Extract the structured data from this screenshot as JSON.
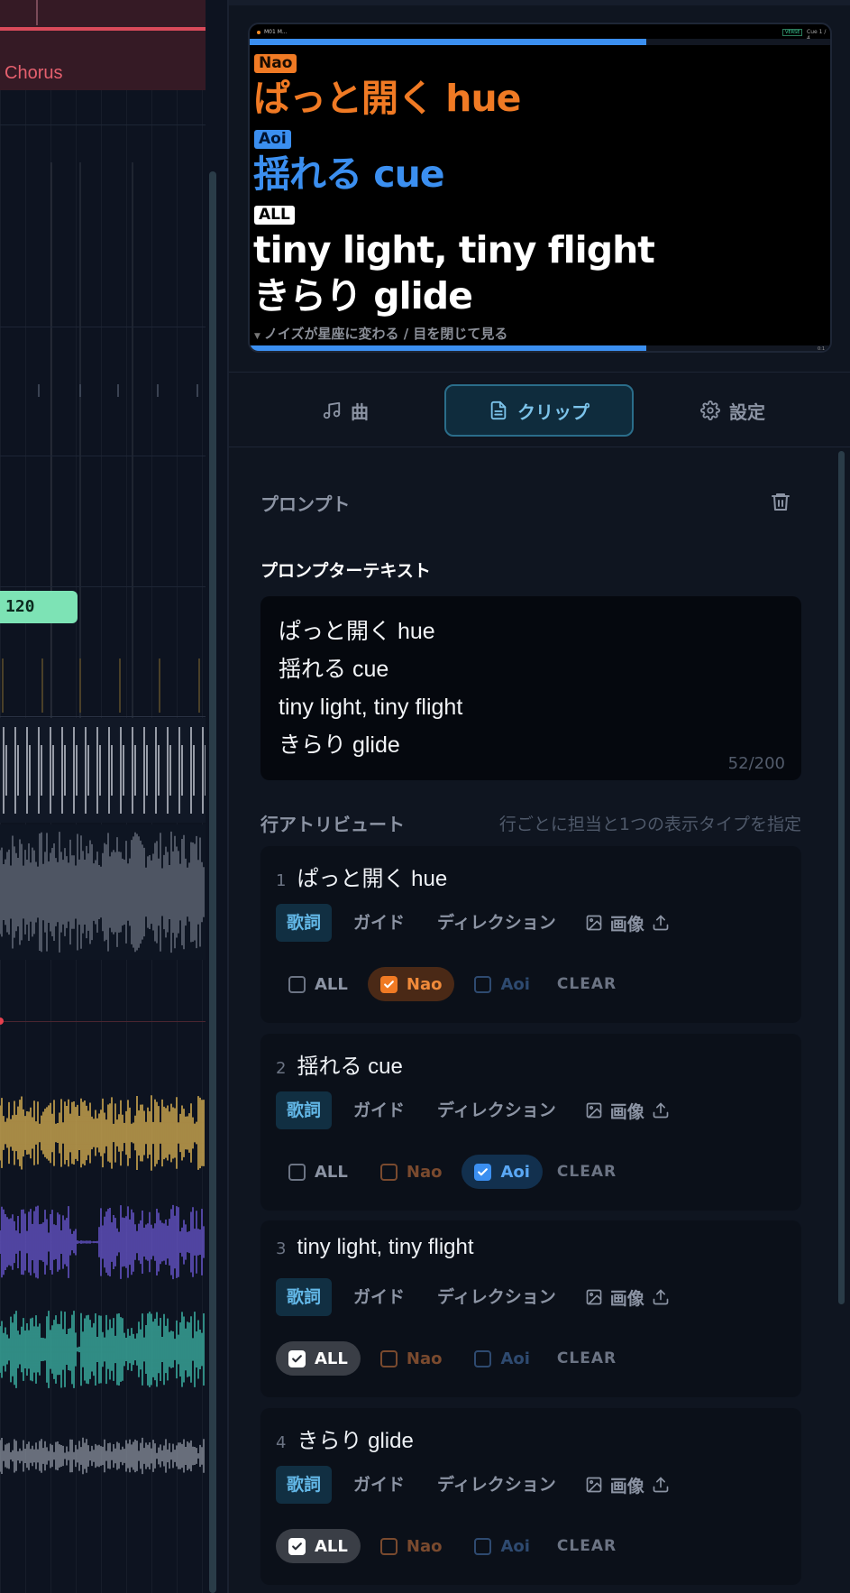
{
  "timeline": {
    "region_label": "Chorus",
    "tempo": "120",
    "colors": {
      "region": "#351a25",
      "region_line": "#d94a5a",
      "tempo": "#7de3b5"
    }
  },
  "preview": {
    "header_title": "M01 M...",
    "section_badge": "VERSE",
    "cue_label": "Cue 1 / 4",
    "lines": [
      {
        "tag": "Nao",
        "text": "ぱっと開く hue",
        "color": "#f07a24"
      },
      {
        "tag": "Aoi",
        "text": "揺れる cue",
        "color": "#3b8ff0"
      },
      {
        "tag": "ALL",
        "text": "tiny light, tiny flight",
        "color": "#ffffff"
      },
      {
        "tag": "",
        "text": "きらり glide",
        "color": "#ffffff"
      }
    ],
    "next_line": "ノイズが星座に変わる / 目を閉じて見る",
    "corner_label": "0:1"
  },
  "tabs": [
    {
      "label": "曲",
      "icon": "music-note-icon"
    },
    {
      "label": "クリップ",
      "icon": "document-icon"
    },
    {
      "label": "設定",
      "icon": "gear-icon"
    }
  ],
  "prompt": {
    "section_title": "プロンプト",
    "field_label": "プロンプターテキスト",
    "text_lines": [
      "ぱっと開く hue",
      "揺れる cue",
      "tiny light, tiny flight",
      "きらり glide"
    ],
    "char_count": "52/200"
  },
  "attributes": {
    "title": "行アトリビュート",
    "hint": "行ごとに担当と1つの表示タイプを指定",
    "type_labels": {
      "lyric": "歌詞",
      "guide": "ガイド",
      "direction": "ディレクション",
      "image": "画像"
    },
    "assign_labels": {
      "all": "ALL",
      "nao": "Nao",
      "aoi": "Aoi",
      "clear": "CLEAR"
    },
    "rows": [
      {
        "num": "1",
        "text": "ぱっと開く hue",
        "type": "lyric",
        "assign": "nao"
      },
      {
        "num": "2",
        "text": "揺れる cue",
        "type": "lyric",
        "assign": "aoi"
      },
      {
        "num": "3",
        "text": "tiny light, tiny flight",
        "type": "lyric",
        "assign": "all"
      },
      {
        "num": "4",
        "text": "きらり glide",
        "type": "lyric",
        "assign": "all"
      }
    ]
  },
  "colors": {
    "nao": "#f07a24",
    "aoi": "#3b8ff0",
    "accent": "#63b8e8"
  }
}
